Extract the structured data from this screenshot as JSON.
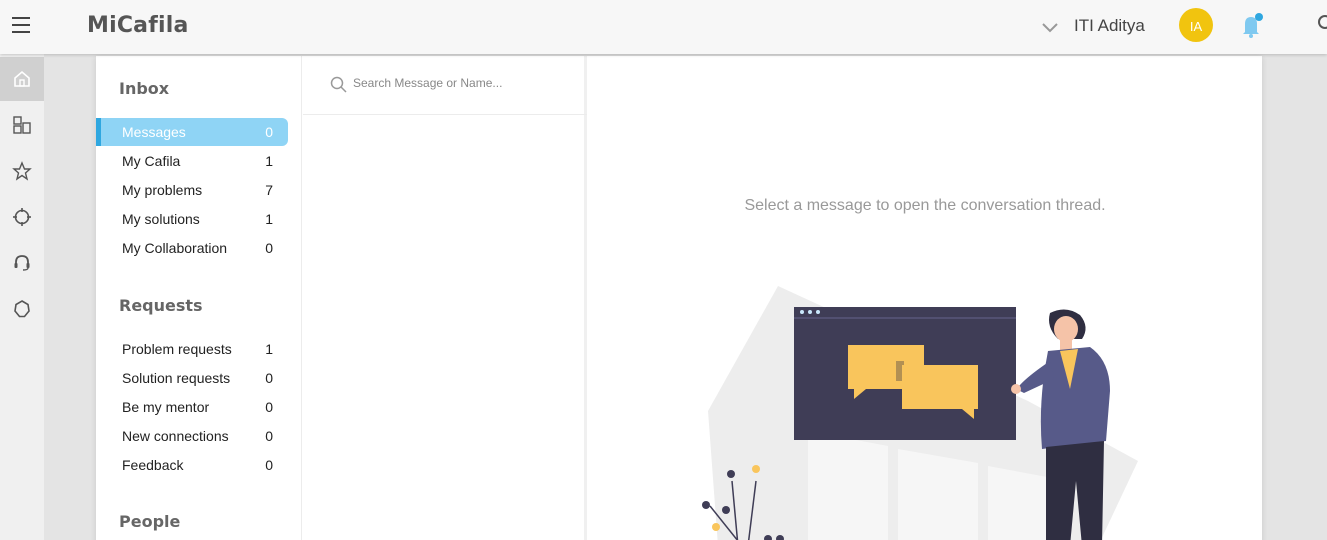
{
  "app": {
    "title": "MiCafila"
  },
  "header": {
    "user_name": "ITI Aditya",
    "avatar_initials": "IA"
  },
  "rail": {
    "items": [
      "home-icon",
      "dashboard-icon",
      "star-badge-icon",
      "target-icon",
      "headset-icon",
      "settings-icon"
    ]
  },
  "inbox": {
    "title": "Inbox",
    "items": [
      {
        "label": "Messages",
        "count": "0"
      },
      {
        "label": "My Cafila",
        "count": "1"
      },
      {
        "label": "My problems",
        "count": "7"
      },
      {
        "label": "My solutions",
        "count": "1"
      },
      {
        "label": "My Collaboration",
        "count": "0"
      }
    ]
  },
  "requests": {
    "title": "Requests",
    "items": [
      {
        "label": "Problem requests",
        "count": "1"
      },
      {
        "label": "Solution requests",
        "count": "0"
      },
      {
        "label": "Be my mentor",
        "count": "0"
      },
      {
        "label": "New connections",
        "count": "0"
      },
      {
        "label": "Feedback",
        "count": "0"
      }
    ]
  },
  "people": {
    "title": "People"
  },
  "search": {
    "placeholder": "Search Message or Name..."
  },
  "thread": {
    "empty_text": "Select a message to open the conversation thread."
  },
  "colors": {
    "accent": "#2fa7e0",
    "active_bg": "#8fd4f5",
    "avatar": "#f1c40f",
    "chat_bubble": "#f9c55c",
    "screen": "#3f3d56",
    "jacket": "#575a89"
  }
}
